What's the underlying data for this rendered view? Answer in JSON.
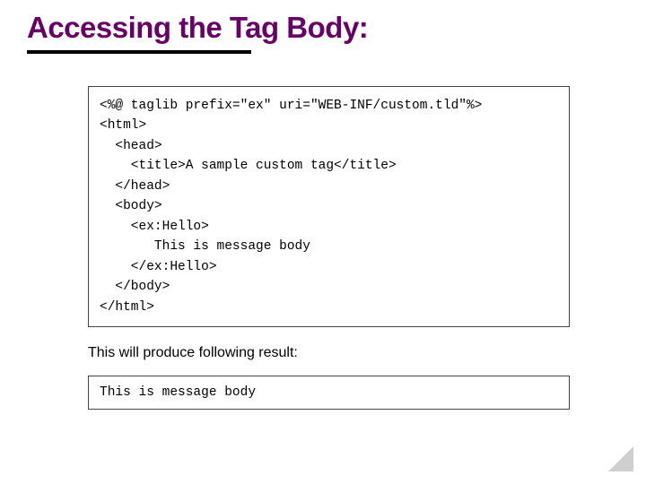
{
  "title": "Accessing the Tag Body:",
  "code": {
    "l1": "<%@ taglib prefix=\"ex\" uri=\"WEB-INF/custom.tld\"%>",
    "l2": "<html>",
    "l3": "  <head>",
    "l4": "    <title>A sample custom tag</title>",
    "l5": "  </head>",
    "l6": "  <body>",
    "l7": "    <ex:Hello>",
    "l8": "       This is message body",
    "l9": "    </ex:Hello>",
    "l10": "  </body>",
    "l11": "</html>"
  },
  "caption": "This will produce following result:",
  "output": "This is message body"
}
